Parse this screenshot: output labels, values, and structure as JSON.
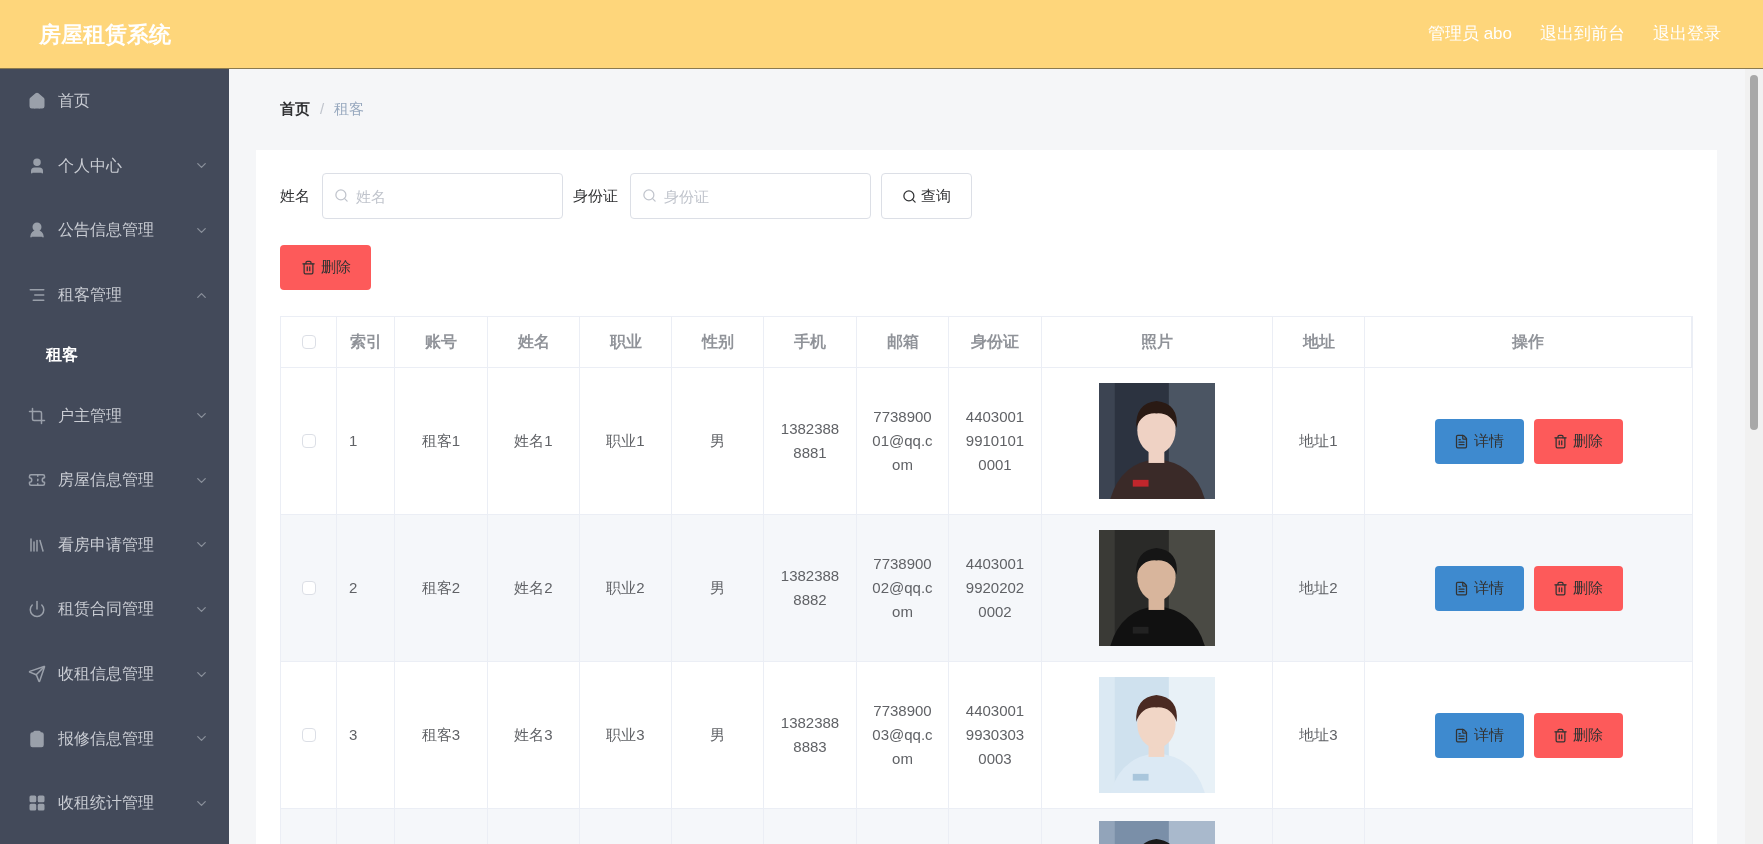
{
  "header": {
    "title": "房屋租赁系统",
    "links": [
      "管理员 abo",
      "退出到前台",
      "退出登录"
    ]
  },
  "sidebar": {
    "items": [
      {
        "label": "首页",
        "kind": "link"
      },
      {
        "label": "个人中心",
        "kind": "menu",
        "expanded": false
      },
      {
        "label": "公告信息管理",
        "kind": "menu",
        "expanded": false
      },
      {
        "label": "租客管理",
        "kind": "menu",
        "expanded": true,
        "children": [
          {
            "label": "租客",
            "selected": true
          }
        ]
      },
      {
        "label": "户主管理",
        "kind": "menu",
        "expanded": false
      },
      {
        "label": "房屋信息管理",
        "kind": "menu",
        "expanded": false
      },
      {
        "label": "看房申请管理",
        "kind": "menu",
        "expanded": false
      },
      {
        "label": "租赁合同管理",
        "kind": "menu",
        "expanded": false
      },
      {
        "label": "收租信息管理",
        "kind": "menu",
        "expanded": false
      },
      {
        "label": "报修信息管理",
        "kind": "menu",
        "expanded": false
      },
      {
        "label": "收租统计管理",
        "kind": "menu",
        "expanded": false
      }
    ]
  },
  "breadcrumb": [
    "首页",
    "租客"
  ],
  "breadcrumb_separator": "/",
  "filters": [
    {
      "label": "姓名",
      "placeholder": "姓名"
    },
    {
      "label": "身份证",
      "placeholder": "身份证"
    }
  ],
  "search_button": "查询",
  "bulk_delete_button": "删除",
  "table": {
    "all_checked": false,
    "columns": [
      "索引",
      "账号",
      "姓名",
      "职业",
      "性别",
      "手机",
      "邮箱",
      "身份证",
      "照片",
      "地址",
      "操作"
    ],
    "rows": [
      {
        "checked": false,
        "cells": [
          "1",
          "租客1",
          "姓名1",
          "职业1",
          "男",
          "13823888881",
          "773890001@qq.com",
          "440300199101010001"
        ],
        "photo": {
          "kind": "picture"
        },
        "address": "地址1",
        "actions": [
          "详情",
          "删除"
        ]
      },
      {
        "checked": false,
        "cells": [
          "2",
          "租客2",
          "姓名2",
          "职业2",
          "男",
          "13823888882",
          "773890002@qq.com",
          "440300199202020002"
        ],
        "photo": {
          "kind": "picture"
        },
        "address": "地址2",
        "actions": [
          "详情",
          "删除"
        ]
      },
      {
        "checked": false,
        "cells": [
          "3",
          "租客3",
          "姓名3",
          "职业3",
          "男",
          "13823888883",
          "773890003@qq.com",
          "440300199303030003"
        ],
        "photo": {
          "kind": "picture"
        },
        "address": "地址3",
        "actions": [
          "详情",
          "删除"
        ]
      },
      {
        "kind": "cut_off",
        "photo": {
          "kind": "picture"
        }
      }
    ]
  }
}
